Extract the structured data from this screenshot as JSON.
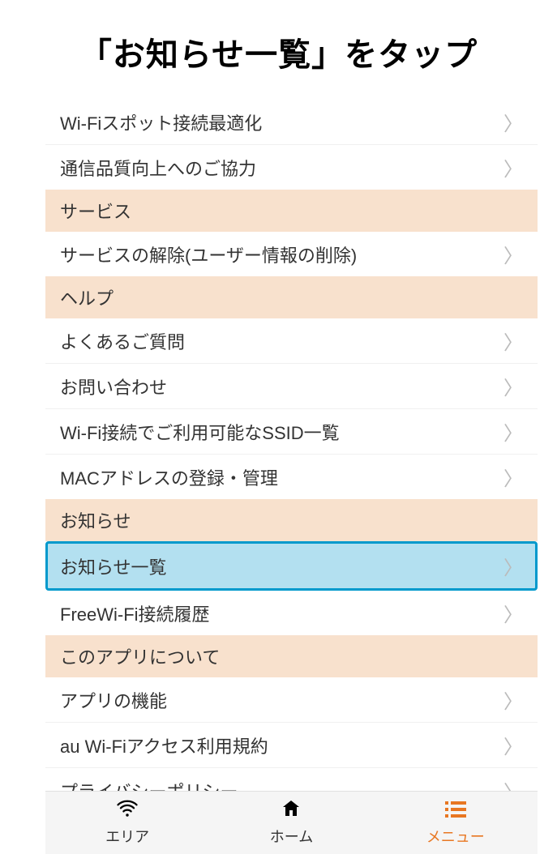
{
  "header": {
    "title": "「お知らせ一覧」をタップ"
  },
  "menu": {
    "topItems": [
      {
        "label": "Wi-Fiスポット接続最適化"
      },
      {
        "label": "通信品質向上へのご協力"
      }
    ],
    "sections": [
      {
        "header": "サービス",
        "items": [
          {
            "label": "サービスの解除(ユーザー情報の削除)"
          }
        ]
      },
      {
        "header": "ヘルプ",
        "items": [
          {
            "label": "よくあるご質問"
          },
          {
            "label": "お問い合わせ"
          },
          {
            "label": "Wi-Fi接続でご利用可能なSSID一覧"
          },
          {
            "label": "MACアドレスの登録・管理"
          }
        ]
      },
      {
        "header": "お知らせ",
        "items": [
          {
            "label": "お知らせ一覧",
            "highlighted": true
          },
          {
            "label": "FreeWi-Fi接続履歴"
          }
        ]
      },
      {
        "header": "このアプリについて",
        "items": [
          {
            "label": "アプリの機能"
          },
          {
            "label": "au Wi-Fiアクセス利用規約"
          },
          {
            "label": "プライバシーポリシー"
          }
        ]
      }
    ]
  },
  "bottomNav": {
    "items": [
      {
        "label": "エリア",
        "icon": "wifi"
      },
      {
        "label": "ホーム",
        "icon": "home"
      },
      {
        "label": "メニュー",
        "icon": "menu",
        "active": true
      }
    ]
  }
}
